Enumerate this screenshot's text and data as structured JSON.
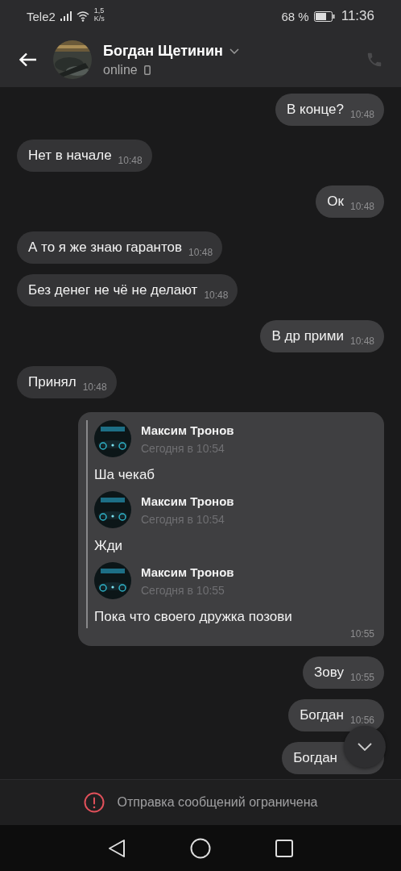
{
  "status_bar": {
    "carrier": "Tele2",
    "speed_value": "1,5",
    "speed_unit": "K/s",
    "battery": "68 %",
    "time": "11:36"
  },
  "header": {
    "name": "Богдан Щетинин",
    "presence": "online"
  },
  "messages": [
    {
      "kind": "text",
      "outgoing": true,
      "text": "В конце?",
      "time": "10:48"
    },
    {
      "kind": "text",
      "outgoing": false,
      "text": "Нет в начале",
      "time": "10:48"
    },
    {
      "kind": "text",
      "outgoing": true,
      "text": "Ок",
      "time": "10:48"
    },
    {
      "kind": "text",
      "outgoing": false,
      "text": "А то я же знаю гарантов",
      "time": "10:48"
    },
    {
      "kind": "text",
      "outgoing": false,
      "text": "Без денег не чё не делают",
      "time": "10:48"
    },
    {
      "kind": "text",
      "outgoing": true,
      "text": "В др прими",
      "time": "10:48"
    },
    {
      "kind": "text",
      "outgoing": false,
      "text": "Принял",
      "time": "10:48"
    },
    {
      "kind": "forward",
      "outgoing": true,
      "time": "10:55",
      "items": [
        {
          "author": "Максим Тронов",
          "date": "Сегодня в 10:54",
          "text": "Ша чекаб"
        },
        {
          "author": "Максим Тронов",
          "date": "Сегодня в 10:54",
          "text": "Жди"
        },
        {
          "author": "Максим Тронов",
          "date": "Сегодня в 10:55",
          "text": "Пока что своего дружка позови"
        }
      ]
    },
    {
      "kind": "text",
      "outgoing": true,
      "text": "Зову",
      "time": "10:55"
    },
    {
      "kind": "text",
      "outgoing": true,
      "text": "Богдан",
      "time": "10:56"
    },
    {
      "kind": "text",
      "outgoing": true,
      "text": "Богдан"
    }
  ],
  "notice": "Отправка сообщений ограничена"
}
